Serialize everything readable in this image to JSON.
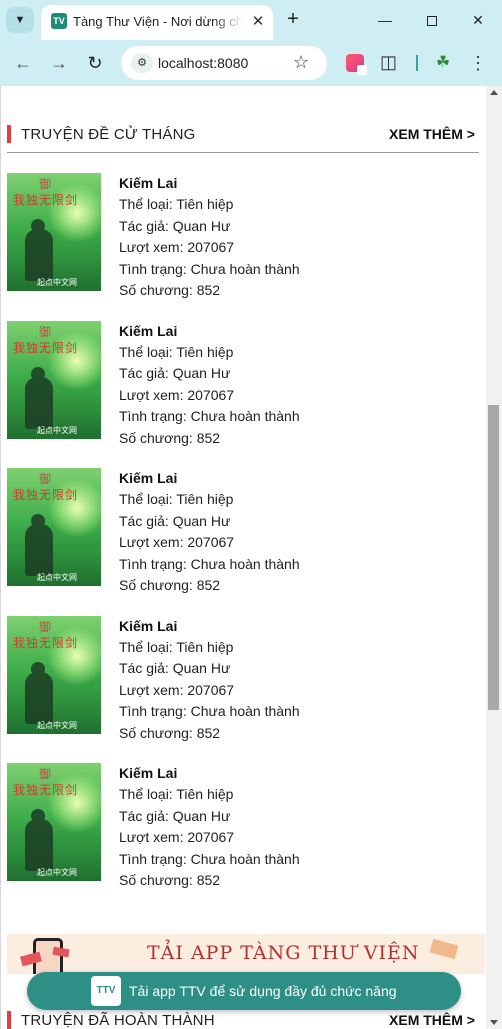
{
  "browser": {
    "tab_title": "Tàng Thư Viện - Nơi dừng chân",
    "tab_favicon_text": "TV",
    "url": "localhost:8080",
    "icons": [
      "tab-search-icon",
      "close-icon",
      "plus-icon",
      "minimize-icon",
      "maximize-icon",
      "close-window-icon",
      "back-icon",
      "forward-icon",
      "reload-icon",
      "site-info-icon",
      "star-icon",
      "extension-icon",
      "puzzle-icon",
      "profile-icon",
      "menu-icon"
    ]
  },
  "section_month": {
    "title": "TRUYỆN ĐỀ CỬ THÁNG",
    "more_label": "XEM THÊM >"
  },
  "stories": [
    {
      "name": "Kiếm Lai",
      "genre": "Thể loại: Tiên hiệp",
      "author": "Tác giả: Quan Hư",
      "views": "Lượt xem: 207067",
      "status": "Tình trạng: Chưa hoàn thành",
      "chapters": "Số chương: 852"
    },
    {
      "name": "Kiếm Lai",
      "genre": "Thể loại: Tiên hiệp",
      "author": "Tác giả: Quan Hư",
      "views": "Lượt xem: 207067",
      "status": "Tình trạng: Chưa hoàn thành",
      "chapters": "Số chương: 852"
    },
    {
      "name": "Kiếm Lai",
      "genre": "Thể loại: Tiên hiệp",
      "author": "Tác giả: Quan Hư",
      "views": "Lượt xem: 207067",
      "status": "Tình trạng: Chưa hoàn thành",
      "chapters": "Số chương: 852"
    },
    {
      "name": "Kiếm Lai",
      "genre": "Thể loại: Tiên hiệp",
      "author": "Tác giả: Quan Hư",
      "views": "Lượt xem: 207067",
      "status": "Tình trạng: Chưa hoàn thành",
      "chapters": "Số chương: 852"
    },
    {
      "name": "Kiếm Lai",
      "genre": "Thể loại: Tiên hiệp",
      "author": "Tác giả: Quan Hư",
      "views": "Lượt xem: 207067",
      "status": "Tình trạng: Chưa hoàn thành",
      "chapters": "Số chương: 852"
    }
  ],
  "cover_art": {
    "seal": "御",
    "title": "我独无限剑",
    "publisher": "起点中文网"
  },
  "banner": {
    "text": "TẢI APP TÀNG THƯ VIỆN"
  },
  "app_cta": {
    "logo_text": "TTV",
    "label": "Tải app TTV để sử dụng đầy đủ chức năng"
  },
  "section_completed": {
    "title": "TRUYỆN ĐÃ HOÀN THÀNH",
    "more_label": "XEM THÊM >"
  },
  "colors": {
    "chrome": "#cfeef3",
    "section_accent": "#e53946",
    "cta": "#2e8f86",
    "banner_text": "#b3322f"
  }
}
